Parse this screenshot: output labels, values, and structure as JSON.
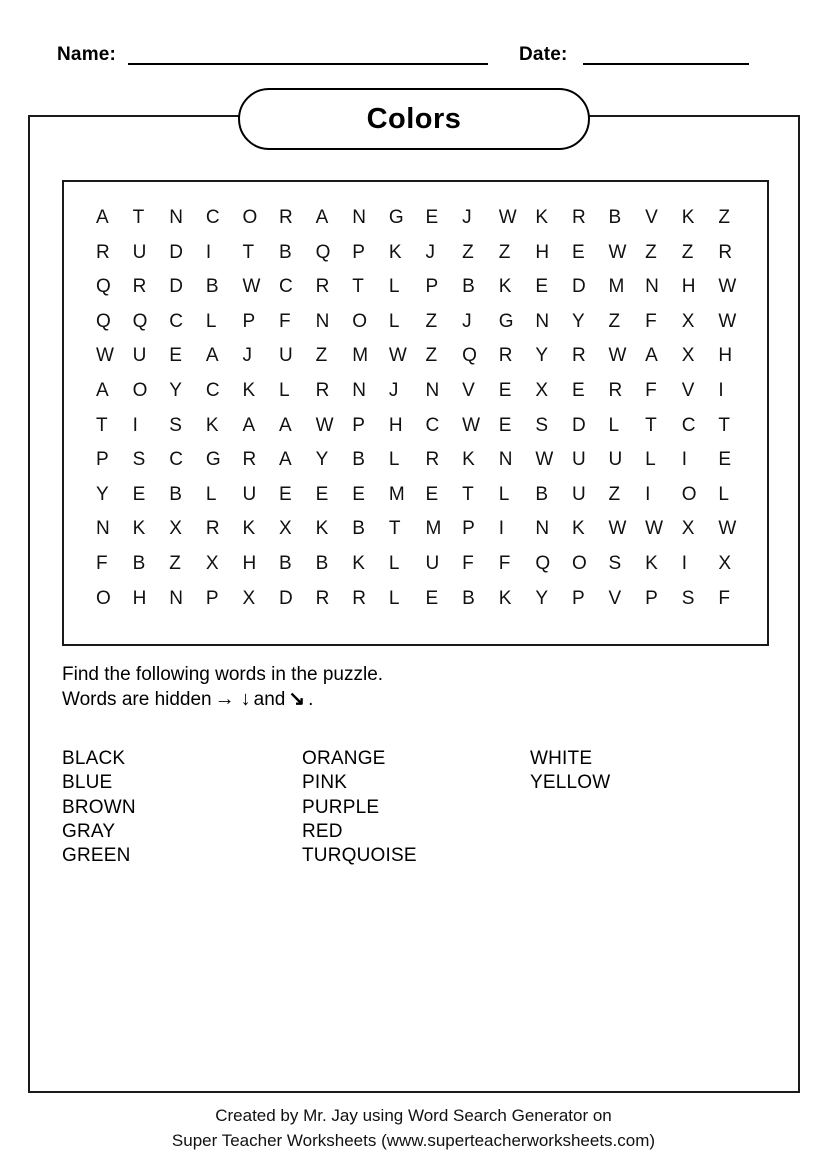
{
  "header": {
    "name_label": "Name:",
    "date_label": "Date:",
    "name_value": "",
    "date_value": ""
  },
  "title": {
    "text": "Colors"
  },
  "puzzle": {
    "rows": 12,
    "cols": 18,
    "grid": [
      [
        "A",
        "T",
        "N",
        "C",
        "O",
        "R",
        "A",
        "N",
        "G",
        "E",
        "J",
        "W",
        "K",
        "R",
        "B",
        "V",
        "K",
        "Z"
      ],
      [
        "R",
        "U",
        "D",
        "I",
        "T",
        "B",
        "Q",
        "P",
        "K",
        "J",
        "Z",
        "Z",
        "H",
        "E",
        "W",
        "Z",
        "Z",
        "R"
      ],
      [
        "Q",
        "R",
        "D",
        "B",
        "W",
        "C",
        "R",
        "T",
        "L",
        "P",
        "B",
        "K",
        "E",
        "D",
        "M",
        "N",
        "H",
        "W"
      ],
      [
        "Q",
        "Q",
        "C",
        "L",
        "P",
        "F",
        "N",
        "O",
        "L",
        "Z",
        "J",
        "G",
        "N",
        "Y",
        "Z",
        "F",
        "X",
        "W"
      ],
      [
        "W",
        "U",
        "E",
        "A",
        "J",
        "U",
        "Z",
        "M",
        "W",
        "Z",
        "Q",
        "R",
        "Y",
        "R",
        "W",
        "A",
        "X",
        "H"
      ],
      [
        "A",
        "O",
        "Y",
        "C",
        "K",
        "L",
        "R",
        "N",
        "J",
        "N",
        "V",
        "E",
        "X",
        "E",
        "R",
        "F",
        "V",
        "I"
      ],
      [
        "T",
        "I",
        "S",
        "K",
        "A",
        "A",
        "W",
        "P",
        "H",
        "C",
        "W",
        "E",
        "S",
        "D",
        "L",
        "T",
        "C",
        "T"
      ],
      [
        "P",
        "S",
        "C",
        "G",
        "R",
        "A",
        "Y",
        "B",
        "L",
        "R",
        "K",
        "N",
        "W",
        "U",
        "U",
        "L",
        "I",
        "E"
      ],
      [
        "Y",
        "E",
        "B",
        "L",
        "U",
        "E",
        "E",
        "E",
        "M",
        "E",
        "T",
        "L",
        "B",
        "U",
        "Z",
        "I",
        "O",
        "L"
      ],
      [
        "N",
        "K",
        "X",
        "R",
        "K",
        "X",
        "K",
        "B",
        "T",
        "M",
        "P",
        "I",
        "N",
        "K",
        "W",
        "W",
        "X",
        "W"
      ],
      [
        "F",
        "B",
        "Z",
        "X",
        "H",
        "B",
        "B",
        "K",
        "L",
        "U",
        "F",
        "F",
        "Q",
        "O",
        "S",
        "K",
        "I",
        "X"
      ],
      [
        "O",
        "H",
        "N",
        "P",
        "X",
        "D",
        "R",
        "R",
        "L",
        "E",
        "B",
        "K",
        "Y",
        "P",
        "V",
        "P",
        "S",
        "F"
      ]
    ]
  },
  "instructions": {
    "line1": "Find the following words in the puzzle.",
    "line2_prefix": "Words are hidden",
    "arrow_right": "→",
    "arrow_down": "↓",
    "conjunction": "and",
    "arrow_diagonal": "↘",
    "line2_suffix": "."
  },
  "word_list": {
    "columns": [
      [
        "BLACK",
        "BLUE",
        "BROWN",
        "GRAY",
        "GREEN"
      ],
      [
        "ORANGE",
        "PINK",
        "PURPLE",
        "RED",
        "TURQUOISE"
      ],
      [
        "WHITE",
        "YELLOW"
      ]
    ]
  },
  "footer": {
    "line1": "Created by Mr. Jay using Word Search Generator on",
    "line2": "Super Teacher Worksheets (www.superteacherworksheets.com)"
  }
}
